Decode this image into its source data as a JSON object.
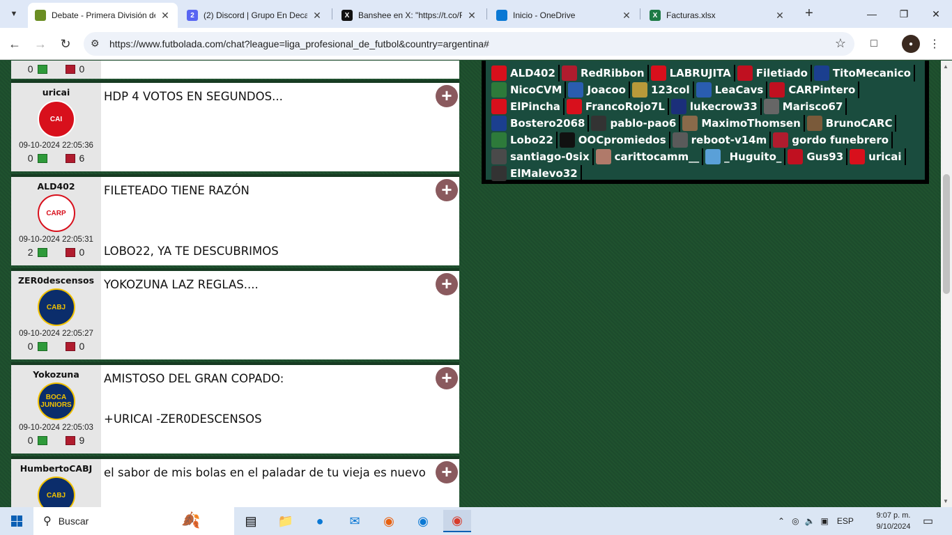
{
  "browser": {
    "tabs": [
      {
        "title": "Debate - Primera División de",
        "fav_color": "#6b8e23",
        "fav_text": "",
        "active": true
      },
      {
        "title": "(2) Discord | Grupo En Decad",
        "fav_color": "#5865f2",
        "fav_text": "2",
        "active": false
      },
      {
        "title": "Banshee en X: \"https://t.co/F",
        "fav_color": "#111111",
        "fav_text": "X",
        "active": false
      },
      {
        "title": "Inicio - OneDrive",
        "fav_color": "#0a78d4",
        "fav_text": "",
        "active": false
      },
      {
        "title": "Facturas.xlsx",
        "fav_color": "#1d7a45",
        "fav_text": "X",
        "active": false
      }
    ],
    "url": "https://www.futbolada.com/chat?league=liga_profesional_de_futbol&country=argentina#"
  },
  "chat": {
    "top_partial": {
      "up": "0",
      "down": "0"
    },
    "messages": [
      {
        "user": "uricai",
        "crest": "CAI",
        "crest_bg": "#d8101c",
        "crest_fg": "#ffffff",
        "date": "09-10-2024 22:05:36",
        "up": "0",
        "down": "6",
        "lines": [
          "HDP 4 VOTOS EN SEGUNDOS..."
        ]
      },
      {
        "user": "ALD402",
        "crest": "CARP",
        "crest_bg": "#ffffff",
        "crest_fg": "#d8101c",
        "date": "09-10-2024 22:05:31",
        "up": "2",
        "down": "0",
        "lines": [
          "FILETEADO TIENE RAZÓN",
          "",
          "",
          "LOBO22, YA TE DESCUBRIMOS"
        ]
      },
      {
        "user": "ZER0descensos",
        "crest": "CABJ",
        "crest_bg": "#0b2d6b",
        "crest_fg": "#f2c200",
        "date": "09-10-2024 22:05:27",
        "up": "0",
        "down": "0",
        "lines": [
          "YOKOZUNA LAZ REGLAS...."
        ]
      },
      {
        "user": "Yokozuna",
        "crest": "BOCA JUNIORS",
        "crest_bg": "#0b2d6b",
        "crest_fg": "#f2c200",
        "date": "09-10-2024 22:05:03",
        "up": "0",
        "down": "9",
        "lines": [
          "AMISTOSO DEL GRAN COPADO:",
          "",
          "+URICAI -ZER0DESCENSOS"
        ]
      },
      {
        "user": "HumbertoCABJ",
        "crest": "CABJ",
        "crest_bg": "#0b2d6b",
        "crest_fg": "#f2c200",
        "date": "",
        "up": "",
        "down": "",
        "lines": [
          "el sabor de mis bolas en el paladar de tu vieja es nuevo"
        ]
      }
    ]
  },
  "online_users": [
    {
      "name": "ALD402",
      "color": "#d8101c"
    },
    {
      "name": "RedRibbon",
      "color": "#b01c2e"
    },
    {
      "name": "LABRUJITA",
      "color": "#d8101c"
    },
    {
      "name": "Filetiado",
      "color": "#c01020"
    },
    {
      "name": "TitoMecanico",
      "color": "#1b3f8f"
    },
    {
      "name": "NicoCVM",
      "color": "#2d7a3a"
    },
    {
      "name": "Joacoo",
      "color": "#2a5db0"
    },
    {
      "name": "123col",
      "color": "#b89a3a"
    },
    {
      "name": "LeaCavs",
      "color": "#2a5db0"
    },
    {
      "name": "CARPintero",
      "color": "#c01020"
    },
    {
      "name": "ElPincha",
      "color": "#d8101c"
    },
    {
      "name": "FrancoRojo7L",
      "color": "#d8101c"
    },
    {
      "name": "lukecrow33",
      "color": "#1b2f7a"
    },
    {
      "name": "Marisco67",
      "color": "#666666"
    },
    {
      "name": "Bostero2068",
      "color": "#1b3f8f"
    },
    {
      "name": "pablo-pao6",
      "color": "#333333"
    },
    {
      "name": "MaximoThomsen",
      "color": "#8a6a4a"
    },
    {
      "name": "BrunoCARC",
      "color": "#7a5a3a"
    },
    {
      "name": "Lobo22",
      "color": "#2d7a3a"
    },
    {
      "name": "OOCpromiedos",
      "color": "#111111"
    },
    {
      "name": "reboot-v14m",
      "color": "#5a5a5a"
    },
    {
      "name": "gordo funebrero",
      "color": "#b01c2e"
    },
    {
      "name": "santiago-0six",
      "color": "#4a4a4a"
    },
    {
      "name": "carittocamm__",
      "color": "#b07a6a"
    },
    {
      "name": "_Huguito_",
      "color": "#5aa0d8"
    },
    {
      "name": "Gus93",
      "color": "#c01020"
    },
    {
      "name": "uricai",
      "color": "#d8101c"
    },
    {
      "name": "ElMalevo32",
      "color": "#333333"
    }
  ],
  "taskbar": {
    "search_label": "Buscar",
    "lang": "ESP",
    "time": "9:07 p. m.",
    "date": "9/10/2024"
  }
}
